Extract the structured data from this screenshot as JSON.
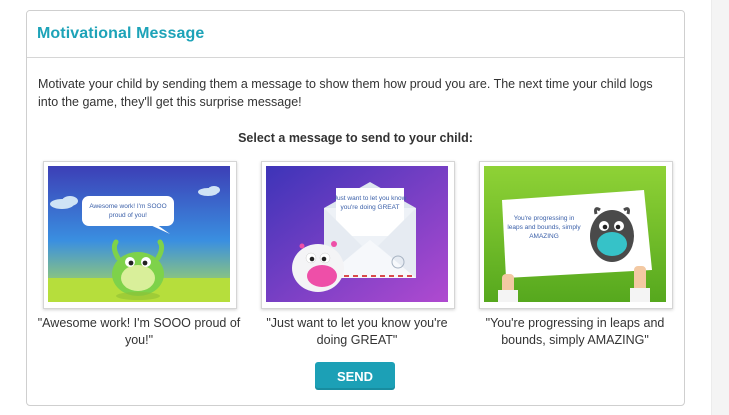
{
  "panel": {
    "title": "Motivational Message",
    "description": "Motivate your child by sending them a message to show them how proud you are. The next time your child logs into the game, they'll get this surprise message!",
    "select_heading": "Select a message to send to your child:"
  },
  "messages": [
    {
      "art_text_line1": "Awesome work! I'm SOOO",
      "art_text_line2": "proud of you!",
      "caption": "\"Awesome work! I'm SOOO proud of you!\""
    },
    {
      "art_text_line1": "Just want to let you know",
      "art_text_line2": "you're doing GREAT",
      "caption": "\"Just want to let you know you're doing GREAT\""
    },
    {
      "art_text_line1": "You're progressing in",
      "art_text_line2": "leaps and bounds, simply",
      "art_text_line3": "AMAZING",
      "caption": "\"You're progressing in leaps and bounds, simply AMAZING\""
    }
  ],
  "send_button": {
    "label": "SEND"
  },
  "colors": {
    "title": "#1da3b8",
    "button": "#1ca0b6",
    "border": "#cfcfcf"
  }
}
